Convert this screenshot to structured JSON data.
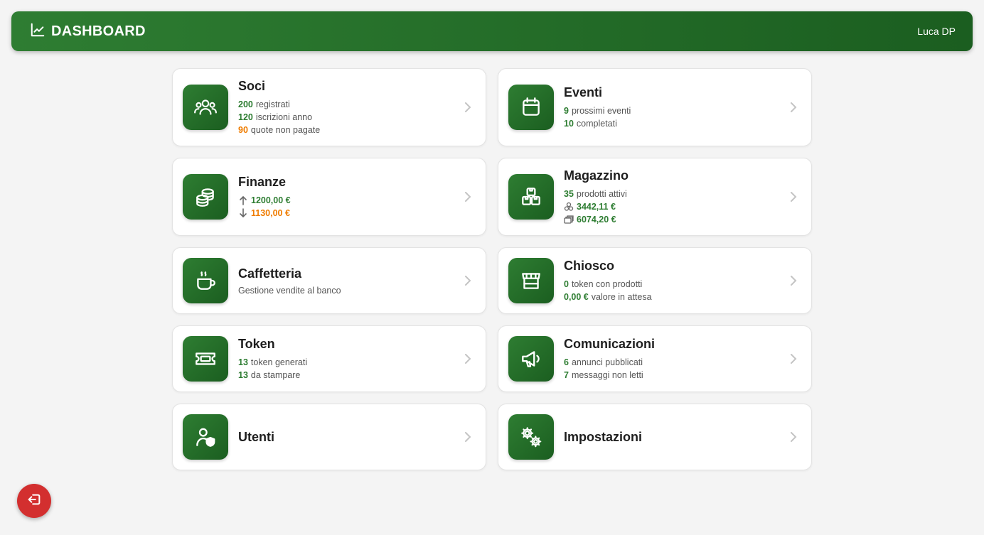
{
  "header": {
    "title": "DASHBOARD",
    "user": "Luca DP",
    "icon": "chart-line-icon"
  },
  "cards": {
    "soci": {
      "title": "Soci",
      "icon": "users-icon",
      "lines": [
        {
          "num": "200",
          "text": "registrati",
          "color": "#2e7d32"
        },
        {
          "num": "120",
          "text": "iscrizioni anno",
          "color": "#2e7d32"
        },
        {
          "num": "90",
          "text": "quote non pagate",
          "color": "#ef7c00"
        }
      ]
    },
    "eventi": {
      "title": "Eventi",
      "icon": "calendar-icon",
      "lines": [
        {
          "num": "9",
          "text": "prossimi eventi"
        },
        {
          "num": "10",
          "text": "completati"
        }
      ]
    },
    "finanze": {
      "title": "Finanze",
      "icon": "coins-icon",
      "income": "1200,00 €",
      "expense": "1130,00 €"
    },
    "magazzino": {
      "title": "Magazzino",
      "icon": "boxes-icon",
      "products_num": "35",
      "products_text": "prodotti attivi",
      "value_a": "3442,11 €",
      "value_b": "6074,20 €"
    },
    "caffetteria": {
      "title": "Caffetteria",
      "icon": "coffee-cup-icon",
      "description": "Gestione vendite al banco"
    },
    "chiosco": {
      "title": "Chiosco",
      "icon": "shop-icon",
      "lines": [
        {
          "num": "0",
          "text": "token con prodotti"
        },
        {
          "num": "0,00 €",
          "text": "valore in attesa"
        }
      ]
    },
    "token": {
      "title": "Token",
      "icon": "ticket-icon",
      "lines": [
        {
          "num": "13",
          "text": "token generati"
        },
        {
          "num": "13",
          "text": "da stampare"
        }
      ]
    },
    "comunicazioni": {
      "title": "Comunicazioni",
      "icon": "megaphone-icon",
      "lines": [
        {
          "num": "6",
          "text": "annunci pubblicati"
        },
        {
          "num": "7",
          "text": "messaggi non letti"
        }
      ]
    },
    "utenti": {
      "title": "Utenti",
      "icon": "user-shield-icon"
    },
    "impostazioni": {
      "title": "Impostazioni",
      "icon": "gears-icon"
    }
  },
  "colors": {
    "primary": "#2e7d32",
    "primary_dark": "#1b5e20",
    "warning": "#ef7c00",
    "danger": "#d32f2f"
  },
  "logout": {
    "icon": "logout-icon"
  }
}
